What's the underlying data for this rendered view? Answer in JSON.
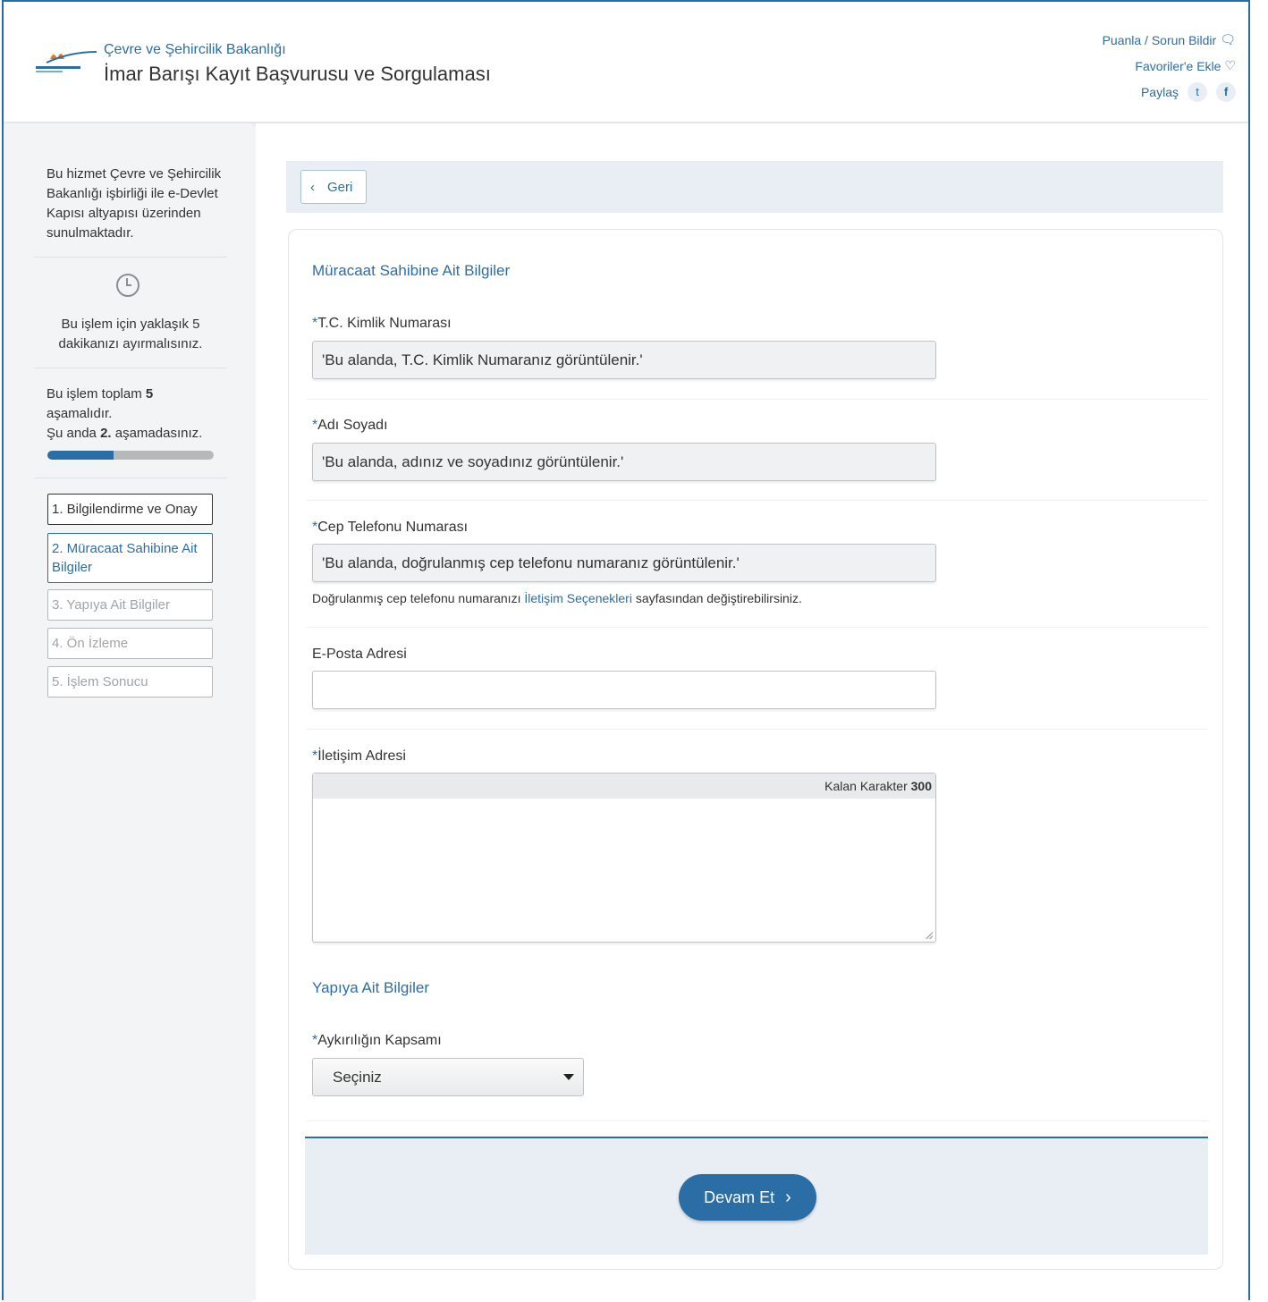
{
  "header": {
    "ministry": "Çevre ve Şehircilik Bakanlığı",
    "service_title": "İmar Barışı Kayıt Başvurusu ve Sorgulaması",
    "links": {
      "rate": "Puanla / Sorun Bildir",
      "favorites": "Favoriler'e Ekle",
      "share": "Paylaş"
    },
    "icons": {
      "rate": "chat-icon",
      "favorites": "heart-icon",
      "twitter": "twitter-icon",
      "facebook": "facebook-icon"
    }
  },
  "sidebar": {
    "description": "Bu hizmet Çevre ve Şehircilik Bakanlığı işbirliği ile e-Devlet Kapısı altyapısı üzerinden sunulmaktadır.",
    "time_note": "Bu işlem için yaklaşık 5 dakikanızı ayırmalısınız.",
    "steps_total_prefix": "Bu işlem toplam ",
    "steps_total": "5",
    "steps_total_suffix": "aşamalıdır.",
    "current_prefix": "Şu anda ",
    "current_step": "2.",
    "current_suffix": " aşamadasınız.",
    "progress": 0.4,
    "steps": [
      {
        "label": "1. Bilgilendirme ve Onay",
        "state": "done"
      },
      {
        "label": "2. Müracaat Sahibine Ait Bilgiler",
        "state": "active"
      },
      {
        "label": "3. Yapıya Ait Bilgiler",
        "state": "future"
      },
      {
        "label": "4. Ön İzleme",
        "state": "future"
      },
      {
        "label": "5. İşlem Sonucu",
        "state": "future"
      }
    ]
  },
  "main": {
    "back_label": "Geri",
    "section1_title": "Müracaat Sahibine Ait Bilgiler",
    "fields": {
      "tc": {
        "label": "T.C. Kimlik Numarası",
        "value": "'Bu alanda, T.C. Kimlik Numaranız görüntülenir.'"
      },
      "name": {
        "label": "Adı Soyadı",
        "value": "'Bu alanda, adınız ve soyadınız görüntülenir.'"
      },
      "phone": {
        "label": "Cep Telefonu Numarası",
        "value": "'Bu alanda, doğrulanmış cep telefonu numaranız görüntülenir.'"
      },
      "email": {
        "label": "E-Posta Adresi",
        "value": ""
      },
      "address": {
        "label": "İletişim Adresi",
        "counter_label": "Kalan Karakter",
        "counter_value": "300"
      }
    },
    "phone_help_prefix": "Doğrulanmış cep telefonu numaranızı ",
    "phone_help_link": "İletişim Seçenekleri",
    "phone_help_suffix": " sayfasından değiştirebilirsiniz.",
    "section2_title": "Yapıya Ait Bilgiler",
    "scope": {
      "label": "Aykırılığın Kapsamı",
      "selected": "Seçiniz"
    },
    "continue_label": "Devam Et"
  },
  "colors": {
    "accent": "#2b6ea5"
  }
}
